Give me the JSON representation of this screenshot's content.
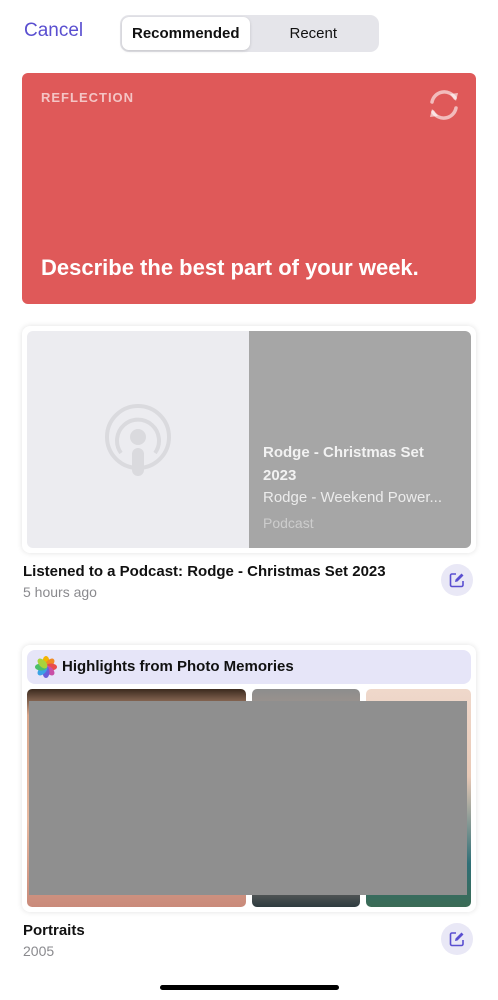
{
  "header": {
    "cancel_label": "Cancel",
    "tabs": [
      {
        "label": "Recommended",
        "active": true
      },
      {
        "label": "Recent",
        "active": false
      }
    ]
  },
  "reflection_card": {
    "label": "REFLECTION",
    "prompt": "Describe the best part of your week.",
    "icon": "refresh-icon",
    "color": "#df5959"
  },
  "podcast_card": {
    "title": "Rodge - Christmas Set 2023",
    "subtitle": "Rodge - Weekend Power...",
    "type": "Podcast",
    "icon": "podcast-icon"
  },
  "podcast_entry": {
    "title": "Listened to a Podcast: Rodge - Christmas Set 2023",
    "time": "5 hours ago"
  },
  "memories_card": {
    "title": "Highlights from Photo Memories",
    "icon": "photos-app-icon"
  },
  "memories_entry": {
    "title": "Portraits",
    "time": "2005"
  },
  "accent_color": "#5a4fd0"
}
